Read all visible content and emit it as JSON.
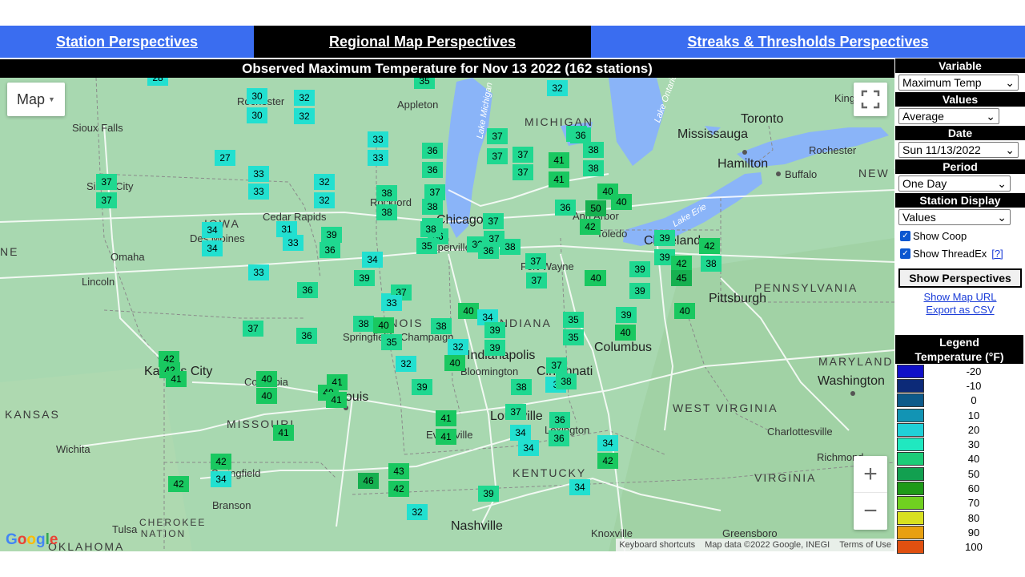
{
  "nav": {
    "tabs": [
      {
        "label": "Station Perspectives"
      },
      {
        "label": "Regional Map Perspectives"
      },
      {
        "label": "Streaks & Thresholds Perspectives"
      }
    ]
  },
  "map": {
    "title": "Observed Maximum Temperature for Nov 13 2022 (162 stations)",
    "type_button": "Map",
    "zoom_in": "+",
    "zoom_out": "−",
    "google_logo": "Google",
    "attribution": [
      "Keyboard shortcuts",
      "Map data ©2022 Google, INEGI",
      "Terms of Use"
    ],
    "places": [
      {
        "name": "Sioux Falls"
      },
      {
        "name": "Sioux City"
      },
      {
        "name": "Rochester"
      },
      {
        "name": "Appleton"
      },
      {
        "name": "MICHIGAN"
      },
      {
        "name": "Toronto"
      },
      {
        "name": "Kings"
      },
      {
        "name": "Mississauga"
      },
      {
        "name": "Hamilton"
      },
      {
        "name": "Rochester"
      },
      {
        "name": "Buffalo"
      },
      {
        "name": "NEW Y"
      },
      {
        "name": "Cedar Rapids"
      },
      {
        "name": "IOWA"
      },
      {
        "name": "Des Moines"
      },
      {
        "name": "Omaha"
      },
      {
        "name": "Lincoln"
      },
      {
        "name": "Rockford"
      },
      {
        "name": "Chicago"
      },
      {
        "name": "Naperville"
      },
      {
        "name": "Fort Wayne"
      },
      {
        "name": "Toledo"
      },
      {
        "name": "Ann Arbor"
      },
      {
        "name": "Cleveland"
      },
      {
        "name": "PENNSYLVANIA"
      },
      {
        "name": "Pittsburgh"
      },
      {
        "name": "ILLINOIS"
      },
      {
        "name": "Springfield"
      },
      {
        "name": "Champaign"
      },
      {
        "name": "INDIANA"
      },
      {
        "name": "Indianapolis"
      },
      {
        "name": "Bloomington"
      },
      {
        "name": "Columbus"
      },
      {
        "name": "Cincinnati"
      },
      {
        "name": "Kansas City"
      },
      {
        "name": "Columbia"
      },
      {
        "name": "St. Louis"
      },
      {
        "name": "MARYLAND"
      },
      {
        "name": "Washington"
      },
      {
        "name": "KANSAS"
      },
      {
        "name": "MISSOURI"
      },
      {
        "name": "WEST VIRGINIA"
      },
      {
        "name": "Louisville"
      },
      {
        "name": "Evansville"
      },
      {
        "name": "Lexington"
      },
      {
        "name": "Charlottesville"
      },
      {
        "name": "Wichita"
      },
      {
        "name": "Springfield"
      },
      {
        "name": "KENTUCKY"
      },
      {
        "name": "Richmond"
      },
      {
        "name": "Branson"
      },
      {
        "name": "VIRGINIA"
      },
      {
        "name": "Tulsa"
      },
      {
        "name": "CHEROKEE NATION"
      },
      {
        "name": "Nashville"
      },
      {
        "name": "Knoxville"
      },
      {
        "name": "Greensboro"
      },
      {
        "name": "OKLAHOMA"
      },
      {
        "name": "Lake Michigan"
      },
      {
        "name": "Lake Erie"
      },
      {
        "name": "Lake Ontario"
      },
      {
        "name": "NE"
      }
    ],
    "stations": [
      {
        "v": "28"
      },
      {
        "v": "35"
      },
      {
        "v": "32"
      },
      {
        "v": "30"
      },
      {
        "v": "32"
      },
      {
        "v": "30"
      },
      {
        "v": "32"
      },
      {
        "v": "36"
      },
      {
        "v": "37"
      },
      {
        "v": "36"
      },
      {
        "v": "38"
      },
      {
        "v": "33"
      },
      {
        "v": "36"
      },
      {
        "v": "33"
      },
      {
        "v": "37"
      },
      {
        "v": "37"
      },
      {
        "v": "41"
      },
      {
        "v": "27"
      },
      {
        "v": "36"
      },
      {
        "v": "37"
      },
      {
        "v": "41"
      },
      {
        "v": "38"
      },
      {
        "v": "37"
      },
      {
        "v": "33"
      },
      {
        "v": "32"
      },
      {
        "v": "37"
      },
      {
        "v": "38"
      },
      {
        "v": "40"
      },
      {
        "v": "37"
      },
      {
        "v": "33"
      },
      {
        "v": "32"
      },
      {
        "v": "38"
      },
      {
        "v": "38"
      },
      {
        "v": "36"
      },
      {
        "v": "50"
      },
      {
        "v": "40"
      },
      {
        "v": "37"
      },
      {
        "v": "38"
      },
      {
        "v": "31"
      },
      {
        "v": "34"
      },
      {
        "v": "42"
      },
      {
        "v": "39"
      },
      {
        "v": "33"
      },
      {
        "v": "34"
      },
      {
        "v": "36"
      },
      {
        "v": "36"
      },
      {
        "v": "35"
      },
      {
        "v": "36"
      },
      {
        "v": "37"
      },
      {
        "v": "38"
      },
      {
        "v": "39"
      },
      {
        "v": "42"
      },
      {
        "v": "38"
      },
      {
        "v": "36"
      },
      {
        "v": "34"
      },
      {
        "v": "37"
      },
      {
        "v": "39"
      },
      {
        "v": "42"
      },
      {
        "v": "38"
      },
      {
        "v": "39"
      },
      {
        "v": "33"
      },
      {
        "v": "40"
      },
      {
        "v": "45"
      },
      {
        "v": "37"
      },
      {
        "v": "39"
      },
      {
        "v": "36"
      },
      {
        "v": "34"
      },
      {
        "v": "37"
      },
      {
        "v": "33"
      },
      {
        "v": "40"
      },
      {
        "v": "39"
      },
      {
        "v": "40"
      },
      {
        "v": "34"
      },
      {
        "v": "37"
      },
      {
        "v": "38"
      },
      {
        "v": "40"
      },
      {
        "v": "38"
      },
      {
        "v": "35"
      },
      {
        "v": "36"
      },
      {
        "v": "39"
      },
      {
        "v": "35"
      },
      {
        "v": "39"
      },
      {
        "v": "40"
      },
      {
        "v": "35"
      },
      {
        "v": "39"
      },
      {
        "v": "32"
      },
      {
        "v": "40"
      },
      {
        "v": "42"
      },
      {
        "v": "32"
      },
      {
        "v": "40"
      },
      {
        "v": "37"
      },
      {
        "v": "42"
      },
      {
        "v": "41"
      },
      {
        "v": "41"
      },
      {
        "v": "40"
      },
      {
        "v": "3"
      },
      {
        "v": "38"
      },
      {
        "v": "40"
      },
      {
        "v": "41"
      },
      {
        "v": "40"
      },
      {
        "v": "39"
      },
      {
        "v": "38"
      },
      {
        "v": "41"
      },
      {
        "v": "37"
      },
      {
        "v": "36"
      },
      {
        "v": "41"
      },
      {
        "v": "34"
      },
      {
        "v": "41"
      },
      {
        "v": "36"
      },
      {
        "v": "34"
      },
      {
        "v": "34"
      },
      {
        "v": "42"
      },
      {
        "v": "42"
      },
      {
        "v": "34"
      },
      {
        "v": "42"
      },
      {
        "v": "46"
      },
      {
        "v": "43"
      },
      {
        "v": "42"
      },
      {
        "v": "39"
      },
      {
        "v": "34"
      },
      {
        "v": "32"
      }
    ]
  },
  "panel": {
    "variable_header": "Variable",
    "variable_value": "Maximum Temp",
    "values_header": "Values",
    "values_value": "Average",
    "date_header": "Date",
    "date_value": "Sun 11/13/2022",
    "period_header": "Period",
    "period_value": "One Day",
    "station_display_header": "Station Display",
    "station_display_value": "Values",
    "show_coop": "Show Coop",
    "show_threadex": "Show ThreadEx",
    "help": "[?]",
    "show_button": "Show Perspectives",
    "show_map_url": "Show Map URL",
    "export_csv": "Export as CSV"
  },
  "legend": {
    "title": "Legend",
    "subtitle": "Temperature (°F)",
    "entries": [
      {
        "value": "-20",
        "color": "#1010c8"
      },
      {
        "value": "-10",
        "color": "#0c2a78"
      },
      {
        "value": "0",
        "color": "#0c5a8a"
      },
      {
        "value": "10",
        "color": "#1294b4"
      },
      {
        "value": "20",
        "color": "#20d0d8"
      },
      {
        "value": "30",
        "color": "#20e8c0"
      },
      {
        "value": "40",
        "color": "#1ccc78"
      },
      {
        "value": "50",
        "color": "#12a050"
      },
      {
        "value": "60",
        "color": "#1e9a18"
      },
      {
        "value": "70",
        "color": "#70d020"
      },
      {
        "value": "80",
        "color": "#d8e020"
      },
      {
        "value": "90",
        "color": "#e8a010"
      },
      {
        "value": "100",
        "color": "#e05010"
      }
    ]
  }
}
